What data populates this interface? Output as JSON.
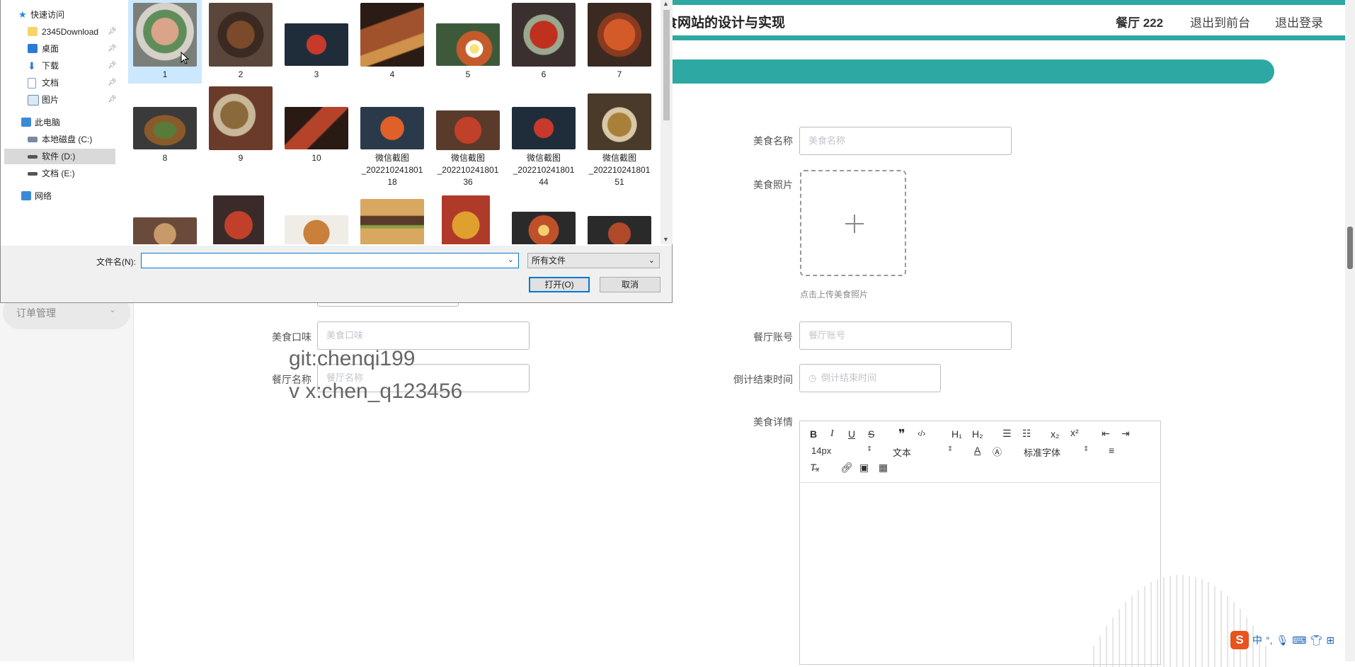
{
  "header": {
    "site_title": "食网站的设计与实现",
    "user_label": "餐厅 222",
    "front_link": "退出到前台",
    "logout_link": "退出登录"
  },
  "sidebar": {
    "menu_label": "订单管理"
  },
  "form": {
    "name_label": "美食名称",
    "name_placeholder": "美食名称",
    "photo_label": "美食照片",
    "photo_hint": "点击上传美食照片",
    "taste_label": "美食口味",
    "taste_placeholder": "美食口味",
    "account_label": "餐厅账号",
    "account_placeholder": "餐厅账号",
    "restaurant_label": "餐厅名称",
    "restaurant_placeholder": "餐厅名称",
    "deadline_label": "倒计结束时间",
    "deadline_placeholder": "倒计结束时间",
    "detail_label": "美食详情"
  },
  "editor": {
    "font_size": "14px",
    "block_type": "文本",
    "font_family": "标准字体"
  },
  "watermark": {
    "line1": "git:chenqi199",
    "line2": "v x:chen_q123456"
  },
  "ime": {
    "lang": "中"
  },
  "dialog": {
    "nav": [
      {
        "label": "快速访问"
      },
      {
        "label": "2345Download"
      },
      {
        "label": "桌面"
      },
      {
        "label": "下载"
      },
      {
        "label": "文档"
      },
      {
        "label": "图片"
      },
      {
        "label": "此电脑"
      },
      {
        "label": "本地磁盘 (C:)"
      },
      {
        "label": "软件 (D:)"
      },
      {
        "label": "文档 (E:)"
      },
      {
        "label": "网络"
      }
    ],
    "files": [
      {
        "name": "1"
      },
      {
        "name": "2"
      },
      {
        "name": "3"
      },
      {
        "name": "4"
      },
      {
        "name": "5"
      },
      {
        "name": "6"
      },
      {
        "name": "7"
      },
      {
        "name": "8"
      },
      {
        "name": "9"
      },
      {
        "name": "10"
      },
      {
        "name": "微信截图_2022102418011 8"
      },
      {
        "name": "微信截图_2022102418013 6"
      },
      {
        "name": "微信截图_2022102418014 4"
      },
      {
        "name": "微信截图_2022102418015 1"
      }
    ],
    "captions": {
      "f11a": "微信截图",
      "f11b": "_202210241801",
      "f11c": "18",
      "f12a": "微信截图",
      "f12b": "_202210241801",
      "f12c": "36",
      "f13a": "微信截图",
      "f13b": "_202210241801",
      "f13c": "44",
      "f14a": "微信截图",
      "f14b": "_202210241801",
      "f14c": "51"
    },
    "filename_label": "文件名(N):",
    "filename_value": "",
    "filetype": "所有文件",
    "open_button": "打开(O)",
    "cancel_button": "取消"
  }
}
